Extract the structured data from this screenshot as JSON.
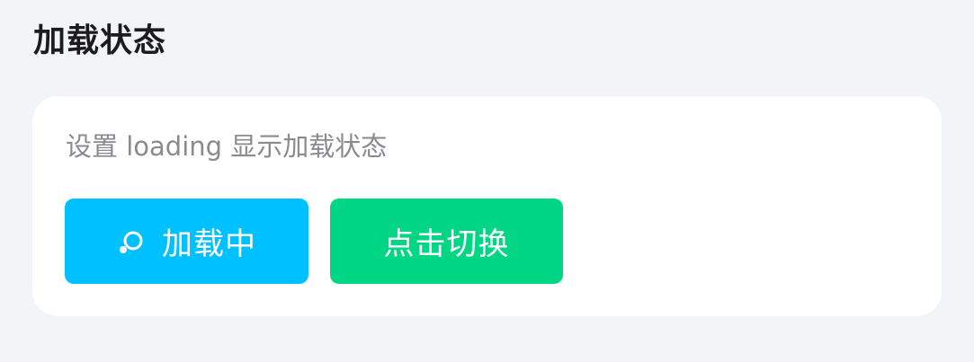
{
  "section": {
    "title": "加载状态"
  },
  "card": {
    "description": "设置 loading 显示加载状态",
    "loading_button": {
      "label": "加载中",
      "icon": "spinner-icon",
      "color": "#00c1ff"
    },
    "toggle_button": {
      "label": "点击切换",
      "color": "#00d684"
    }
  }
}
